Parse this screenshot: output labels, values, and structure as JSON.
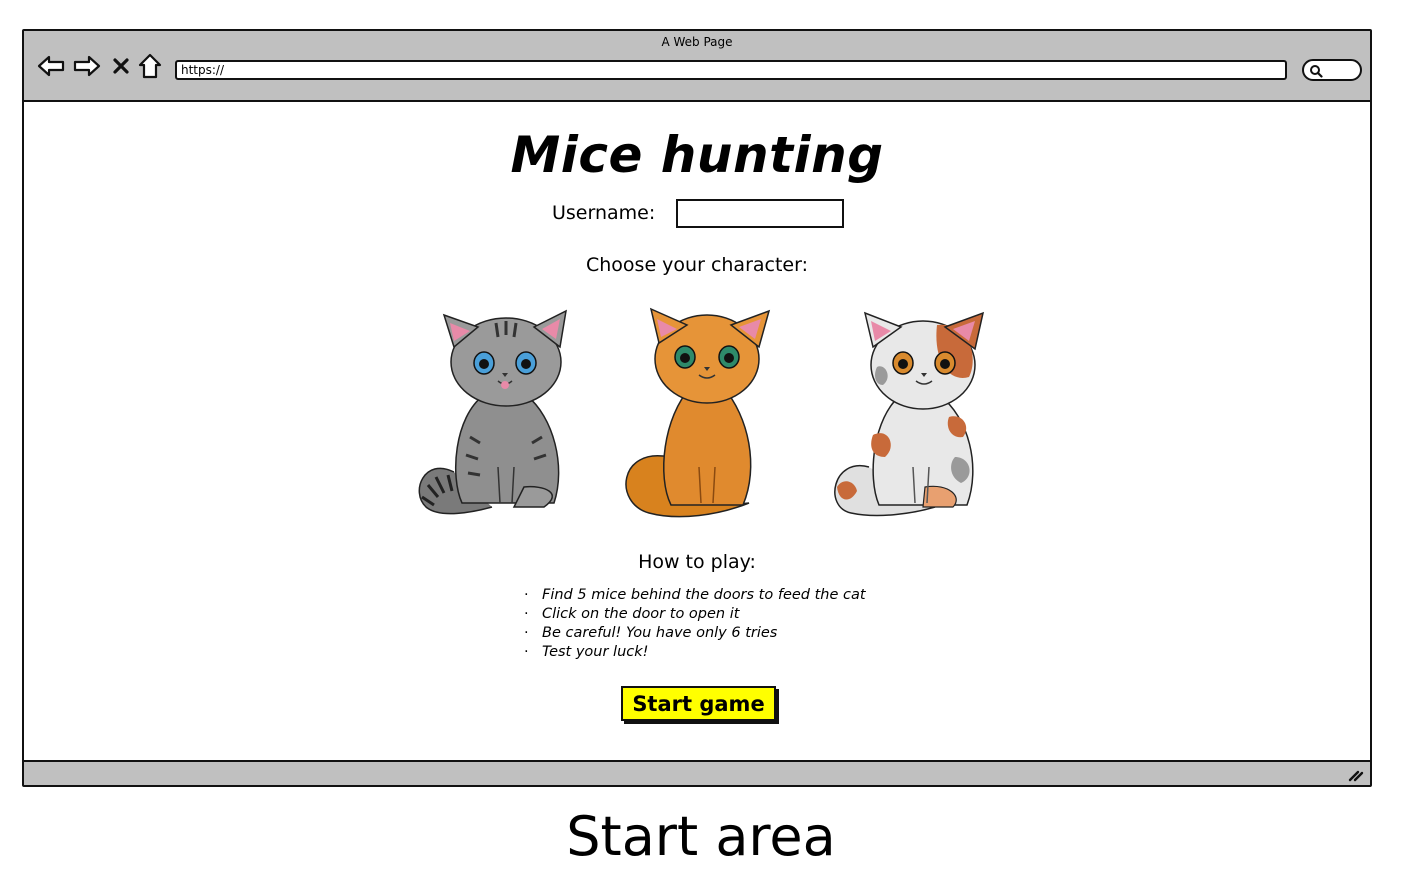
{
  "window": {
    "title": "A Web Page"
  },
  "toolbar": {
    "back_icon": "back-arrow-icon",
    "forward_icon": "forward-arrow-icon",
    "stop_icon": "close-icon",
    "home_icon": "home-icon",
    "url": "https://",
    "search_icon": "search-icon"
  },
  "page": {
    "title": "Mice hunting",
    "username_label": "Username:",
    "username_value": "",
    "choose_label": "Choose your character:",
    "characters": [
      {
        "name": "grey-tabby-cat",
        "icon": "cat-icon",
        "colors": [
          "#8e8e8e",
          "#3a3a3a",
          "#4a9fd8"
        ]
      },
      {
        "name": "orange-cat",
        "icon": "cat-icon",
        "colors": [
          "#e08a2e",
          "#c86a18",
          "#2e8a6a"
        ]
      },
      {
        "name": "calico-cat",
        "icon": "cat-icon",
        "colors": [
          "#e8e8e8",
          "#c86a3a",
          "#9a9a9a"
        ]
      }
    ],
    "howto_label": "How to play:",
    "rules": [
      "Find 5 mice behind the doors to feed the cat",
      "Click on the door to open it",
      "Be careful! You have only 6 tries",
      "Test your luck!"
    ],
    "start_label": "Start game"
  },
  "caption": "Start area",
  "colors": {
    "chrome": "#c0c0c0",
    "button": "#ffff00"
  }
}
